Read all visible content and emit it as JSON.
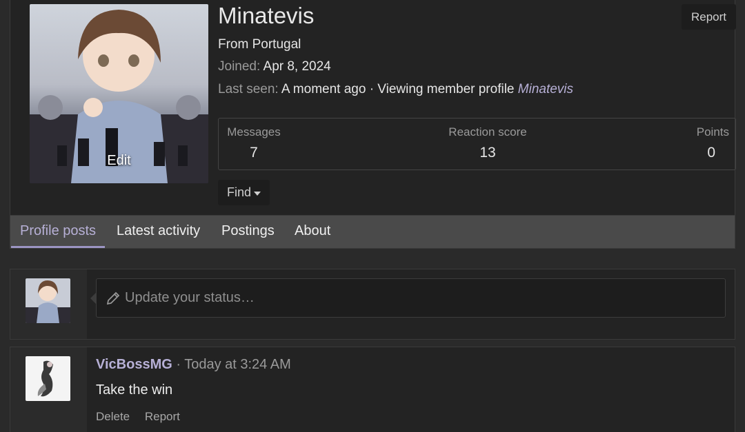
{
  "profile": {
    "username": "Minatevis",
    "report_label": "Report",
    "avatar_edit_label": "Edit",
    "from_text": "From Portugal",
    "joined_label": "Joined:",
    "joined_value": "Apr 8, 2024",
    "last_seen_label": "Last seen:",
    "last_seen_value": "A moment ago · Viewing member profile",
    "last_seen_link": "Minatevis",
    "find_label": "Find"
  },
  "stats": [
    {
      "label": "Messages",
      "value": "7"
    },
    {
      "label": "Reaction score",
      "value": "13"
    },
    {
      "label": "Points",
      "value": "0"
    }
  ],
  "tabs": [
    {
      "label": "Profile posts",
      "active": true
    },
    {
      "label": "Latest activity",
      "active": false
    },
    {
      "label": "Postings",
      "active": false
    },
    {
      "label": "About",
      "active": false
    }
  ],
  "status": {
    "placeholder": "Update your status…"
  },
  "post": {
    "author": "VicBossMG",
    "separator": " · ",
    "time": "Today at 3:24 AM",
    "body": "Take the win",
    "actions": [
      "Delete",
      "Report"
    ]
  },
  "colors": {
    "accent": "#b7b0d6",
    "background": "#2a2a2a",
    "panel": "#232323"
  },
  "icons": [
    "pencil-icon",
    "caret-down-icon"
  ]
}
